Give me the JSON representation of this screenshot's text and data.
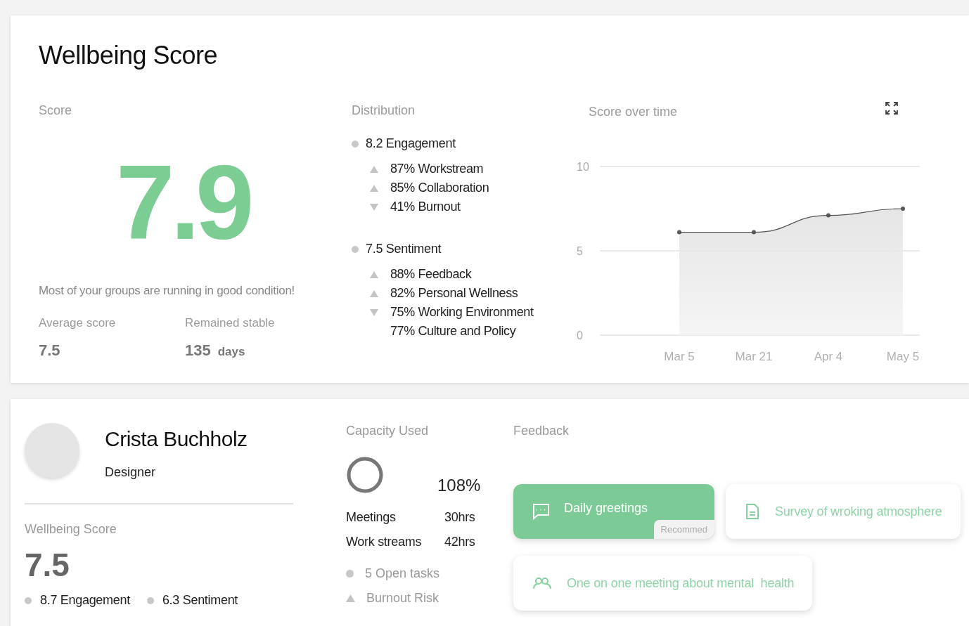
{
  "score_card": {
    "title": "Wellbeing Score",
    "score": {
      "label": "Score",
      "value": "7.9",
      "message": "Most of your groups are running in good condition!",
      "average_label": "Average score",
      "average_value": "7.5",
      "stable_label": "Remained stable",
      "stable_value": "135",
      "stable_unit": "days"
    },
    "distribution": {
      "label": "Distribution",
      "groups": [
        {
          "title": "8.2 Engagement",
          "items": [
            {
              "text": "87% Workstream",
              "kind": "up"
            },
            {
              "text": "85% Collaboration",
              "kind": "up"
            },
            {
              "text": "41% Burnout",
              "kind": "down"
            }
          ]
        },
        {
          "title": "7.5 Sentiment",
          "items": [
            {
              "text": "88% Feedback",
              "kind": "up"
            },
            {
              "text": "82% Personal Wellness",
              "kind": "up"
            },
            {
              "text": "75% Working Environment",
              "kind": "down"
            },
            {
              "text": "77% Culture and Policy",
              "kind": "plain"
            }
          ]
        }
      ]
    },
    "score_over_time": {
      "label": "Score over time",
      "chart_data": {
        "type": "area",
        "categories": [
          "Mar 5",
          "Mar 21",
          "Apr 4",
          "May 5"
        ],
        "series": [
          {
            "color": "#555555",
            "values": [
              6.1,
              6.1,
              7.1,
              7.5
            ]
          }
        ],
        "ylim": [
          0,
          10
        ],
        "yticks": [
          0,
          5,
          10
        ]
      }
    }
  },
  "person_card": {
    "name": "Crista Buchholz",
    "role": "Designer",
    "wellbeing_label": "Wellbeing Score",
    "wellbeing_value": "7.5",
    "metrics": [
      "8.7 Engagement",
      "6.3 Sentiment"
    ],
    "capacity": {
      "label": "Capacity Used",
      "level": 1,
      "percent": "108%",
      "rows": [
        {
          "label": "Meetings",
          "value": "30hrs"
        },
        {
          "label": "Work streams",
          "value": "42hrs"
        }
      ],
      "notes": [
        {
          "text": "5 Open tasks",
          "kind": "dot"
        },
        {
          "text": "Burnout Risk",
          "kind": "triangle"
        }
      ]
    },
    "feedback": {
      "label": "Feedback",
      "items": [
        {
          "text": "Daily greetings",
          "kind": "primary",
          "badge": "Recommed"
        },
        {
          "text": "Survey of wroking atmosphere",
          "kind": "outline"
        },
        {
          "text": "One on one meeting about mental  health",
          "kind": "outline"
        }
      ]
    }
  }
}
